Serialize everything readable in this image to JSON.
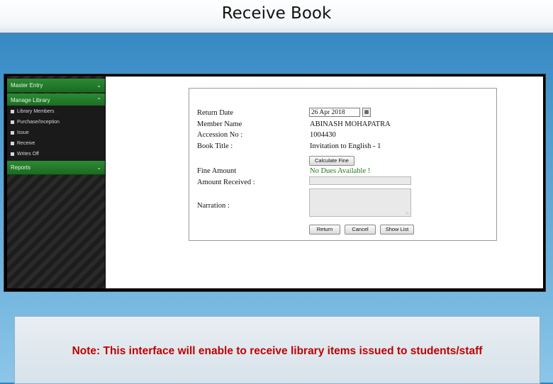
{
  "slide": {
    "title": "Receive Book",
    "note": "Note: This interface will enable to receive library items issued to students/staff"
  },
  "sidebar": {
    "menus": [
      {
        "label": "Master Entry",
        "chevron": "chevron-down"
      },
      {
        "label": "Manage Library",
        "chevron": "chevron-up"
      },
      {
        "label": "Reports",
        "chevron": "chevron-down"
      }
    ],
    "items": [
      {
        "label": "Library Members",
        "icon": "bullet-square"
      },
      {
        "label": "Purchase/Inception",
        "icon": "bullet-square"
      },
      {
        "label": "Issue",
        "icon": "bullet-square"
      },
      {
        "label": "Receive",
        "icon": "bullet-square"
      },
      {
        "label": "Writes Off",
        "icon": "bullet-square"
      }
    ]
  },
  "form": {
    "return_date_label": "Return Date",
    "return_date_value": "26 Apr 2018",
    "member_name_label": "Member Name",
    "member_name_value": "ABINASH MOHAPATRA",
    "accession_label": "Accession No :",
    "accession_value": "1004430",
    "book_title_label": "Book Title :",
    "book_title_value": "Invitation to English - 1",
    "calculate_fine_label": "Calculate Fine",
    "fine_amount_label": "Fine Amount",
    "fine_status": "No Dues Available !",
    "amount_received_label": "Amount Received :",
    "amount_received_value": "",
    "narration_label": "Narration :",
    "narration_value": "",
    "return_button": "Return",
    "cancel_button": "Cancel",
    "show_list_button": "Show List"
  },
  "colors": {
    "menu_green": "#2c8a32",
    "note_red": "#c00000",
    "fine_status_green": "#1e7a1e"
  }
}
